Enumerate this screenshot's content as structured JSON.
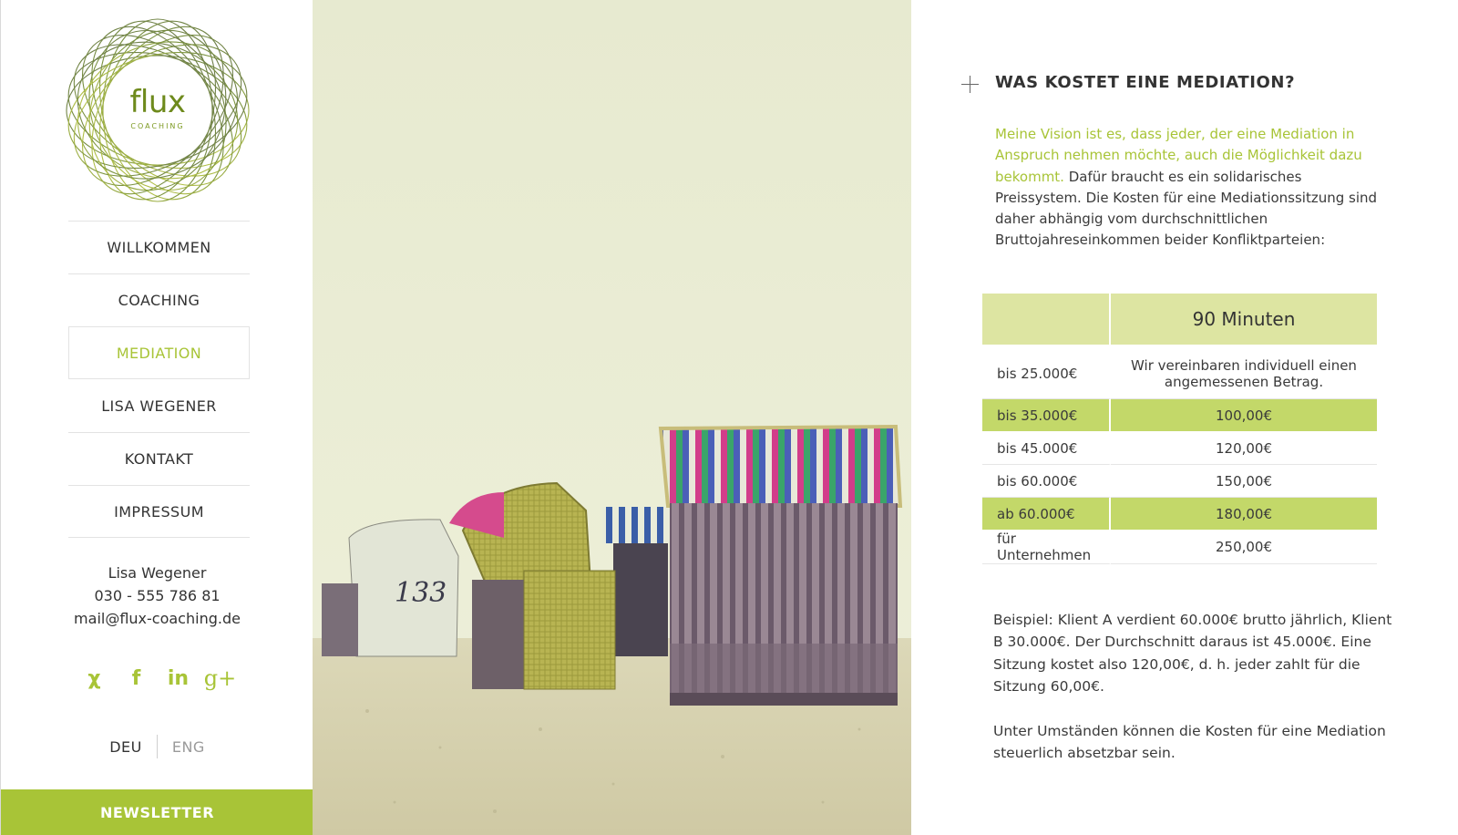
{
  "brand": {
    "name": "flux",
    "tagline": "COACHING"
  },
  "nav": {
    "items": [
      {
        "label": "WILLKOMMEN"
      },
      {
        "label": "COACHING"
      },
      {
        "label": "MEDIATION"
      },
      {
        "label": "LISA WEGENER"
      },
      {
        "label": "KONTAKT"
      },
      {
        "label": "IMPRESSUM"
      }
    ],
    "active": "MEDIATION"
  },
  "contact": {
    "name": "Lisa Wegener",
    "phone": "030 - 555 786 81",
    "email": "mail@flux-coaching.de"
  },
  "social": {
    "xing": "χ",
    "facebook": "f",
    "linkedin": "in",
    "googleplus": "g+"
  },
  "language": {
    "current": "DEU",
    "other": "ENG"
  },
  "newsletter": {
    "label": "NEWSLETTER"
  },
  "colors": {
    "accent": "#a8c437",
    "accent_light": "#dde5a2",
    "accent_row": "#c3d869",
    "text": "#3a3a3a"
  },
  "content": {
    "heading": "WAS KOSTET EINE MEDIATION?",
    "intro_highlight": "Meine Vision ist es, dass jeder, der eine Mediation in Anspruch nehmen möchte, auch die Möglichkeit dazu bekommt.",
    "intro_rest": " Dafür braucht es ein solidarisches Preissystem. Die Kosten für eine Mediationssitzung sind daher abhängig vom durchschnittlichen Bruttojahreseinkommen beider Konfliktparteien:",
    "table": {
      "header": "90 Minuten",
      "rows": [
        {
          "income": "bis 25.000€",
          "price": "Wir vereinbaren individuell einen angemessenen Betrag."
        },
        {
          "income": "bis 35.000€",
          "price": "100,00€"
        },
        {
          "income": "bis 45.000€",
          "price": "120,00€"
        },
        {
          "income": "bis 60.000€",
          "price": "150,00€"
        },
        {
          "income": "ab 60.000€",
          "price": "180,00€"
        },
        {
          "income": "für Unternehmen",
          "price": "250,00€"
        }
      ]
    },
    "example": "Beispiel: Klient A verdient 60.000€ brutto jährlich, Klient B 30.000€. Der Durchschnitt daraus ist 45.000€. Eine Sitzung kostet also 120,00€, d. h. jeder zahlt für die Sitzung 60,00€.",
    "note": "Unter Umständen können die Kosten für eine Mediation steuerlich absetzbar sein."
  }
}
